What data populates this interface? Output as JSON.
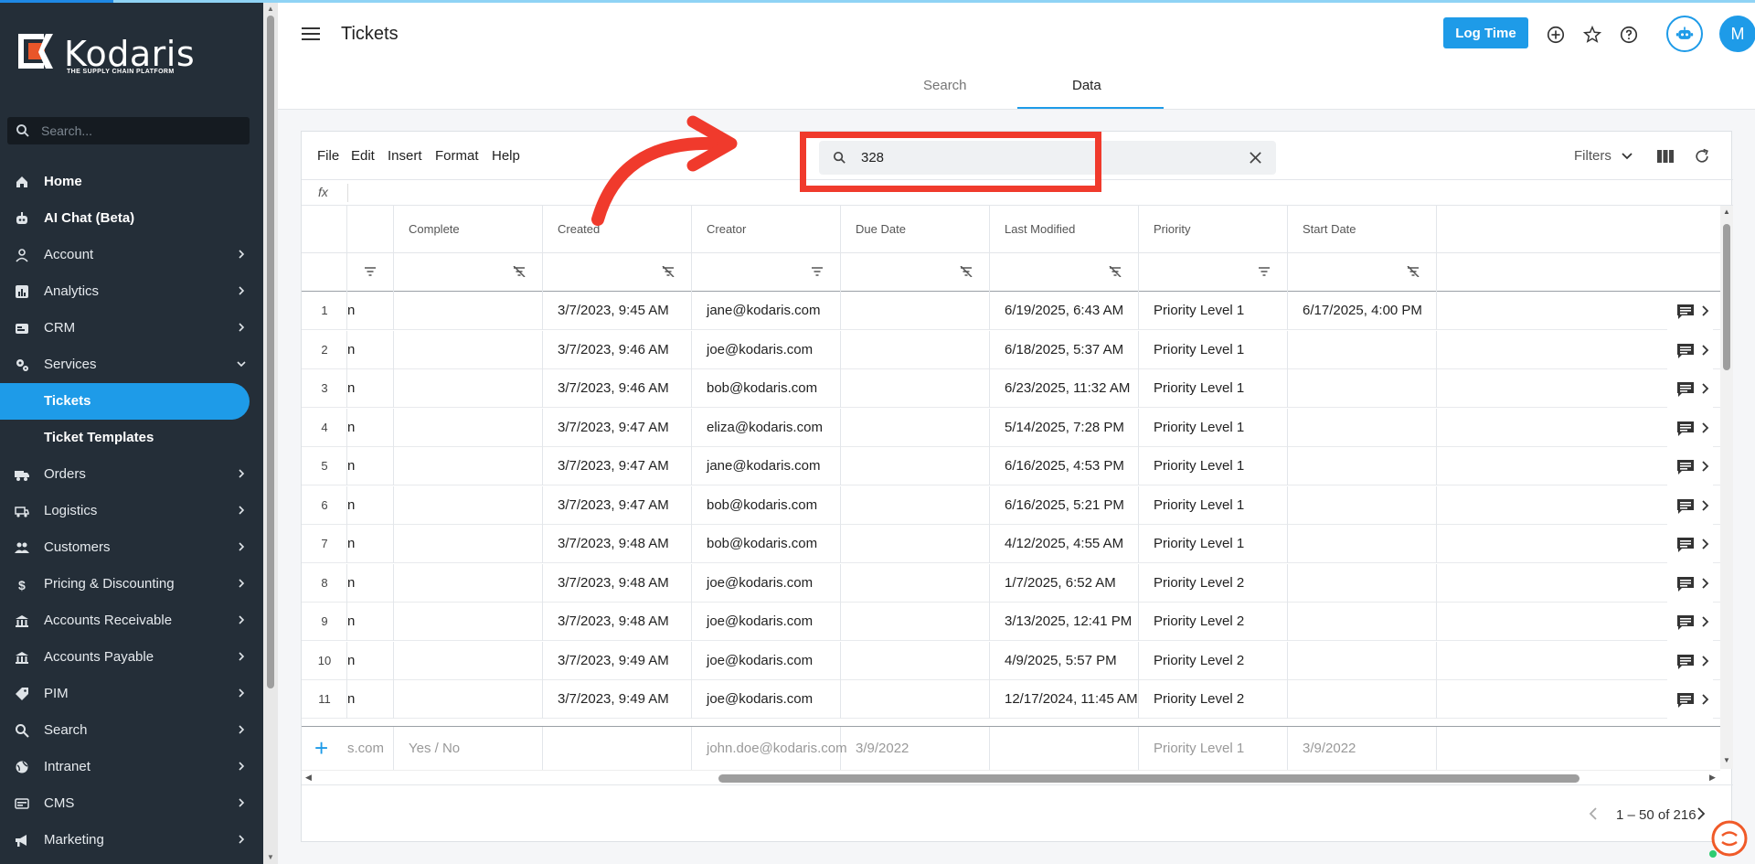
{
  "app": {
    "brand_name": "Kodaris",
    "brand_tagline": "THE SUPPLY CHAIN PLATFORM",
    "page_title": "Tickets"
  },
  "sidebar": {
    "search_placeholder": "Search...",
    "items": [
      {
        "label": "Home",
        "icon": "home-icon",
        "bold": true,
        "chevron": false
      },
      {
        "label": "AI Chat (Beta)",
        "icon": "robot-icon",
        "bold": true,
        "chevron": false
      },
      {
        "label": "Account",
        "icon": "person-icon",
        "chevron": true
      },
      {
        "label": "Analytics",
        "icon": "chart-icon",
        "chevron": true
      },
      {
        "label": "CRM",
        "icon": "crm-icon",
        "chevron": true
      },
      {
        "label": "Services",
        "icon": "gears-icon",
        "chevron": true,
        "expanded": true
      },
      {
        "label": "Tickets",
        "active": true,
        "sub": true
      },
      {
        "label": "Ticket Templates",
        "sub": true
      },
      {
        "label": "Orders",
        "icon": "truck-icon",
        "chevron": true
      },
      {
        "label": "Logistics",
        "icon": "logistics-icon",
        "chevron": true
      },
      {
        "label": "Customers",
        "icon": "people-icon",
        "chevron": true
      },
      {
        "label": "Pricing & Discounting",
        "icon": "dollar-icon",
        "chevron": true
      },
      {
        "label": "Accounts Receivable",
        "icon": "bank-icon",
        "chevron": true
      },
      {
        "label": "Accounts Payable",
        "icon": "bank-icon",
        "chevron": true
      },
      {
        "label": "PIM",
        "icon": "tag-icon",
        "chevron": true
      },
      {
        "label": "Search",
        "icon": "search-icon",
        "chevron": true
      },
      {
        "label": "Intranet",
        "icon": "globe-icon",
        "chevron": true
      },
      {
        "label": "CMS",
        "icon": "cms-icon",
        "chevron": true
      },
      {
        "label": "Marketing",
        "icon": "megaphone-icon",
        "chevron": true
      }
    ]
  },
  "header": {
    "log_time_label": "Log Time",
    "avatar_initial": "M",
    "tabs": [
      {
        "label": "Search",
        "active": false
      },
      {
        "label": "Data",
        "active": true
      }
    ]
  },
  "toolbar": {
    "menus": [
      "File",
      "Edit",
      "Insert",
      "Format",
      "Help"
    ],
    "search_value": "328",
    "filters_label": "Filters",
    "formula_label": "fx"
  },
  "grid": {
    "columns": [
      "Complete",
      "Created",
      "Creator",
      "Due Date",
      "Last Modified",
      "Priority",
      "Start Date"
    ],
    "rows": [
      {
        "n": "1",
        "c0": "n",
        "complete": "",
        "created": "3/7/2023, 9:45 AM",
        "creator": "jane@kodaris.com",
        "due": "",
        "modified": "6/19/2025, 6:43 AM",
        "priority": "Priority Level 1",
        "start": "6/17/2025, 4:00 PM"
      },
      {
        "n": "2",
        "c0": "n",
        "complete": "",
        "created": "3/7/2023, 9:46 AM",
        "creator": "joe@kodaris.com",
        "due": "",
        "modified": "6/18/2025, 5:37 AM",
        "priority": "Priority Level 1",
        "start": ""
      },
      {
        "n": "3",
        "c0": "n",
        "complete": "",
        "created": "3/7/2023, 9:46 AM",
        "creator": "bob@kodaris.com",
        "due": "",
        "modified": "6/23/2025, 11:32 AM",
        "priority": "Priority Level 1",
        "start": ""
      },
      {
        "n": "4",
        "c0": "n",
        "complete": "",
        "created": "3/7/2023, 9:47 AM",
        "creator": "eliza@kodaris.com",
        "due": "",
        "modified": "5/14/2025, 7:28 PM",
        "priority": "Priority Level 1",
        "start": ""
      },
      {
        "n": "5",
        "c0": "n",
        "complete": "",
        "created": "3/7/2023, 9:47 AM",
        "creator": "jane@kodaris.com",
        "due": "",
        "modified": "6/16/2025, 4:53 PM",
        "priority": "Priority Level 1",
        "start": ""
      },
      {
        "n": "6",
        "c0": "n",
        "complete": "",
        "created": "3/7/2023, 9:47 AM",
        "creator": "bob@kodaris.com",
        "due": "",
        "modified": "6/16/2025, 5:21 PM",
        "priority": "Priority Level 1",
        "start": ""
      },
      {
        "n": "7",
        "c0": "n",
        "complete": "",
        "created": "3/7/2023, 9:48 AM",
        "creator": "bob@kodaris.com",
        "due": "",
        "modified": "4/12/2025, 4:55 AM",
        "priority": "Priority Level 1",
        "start": ""
      },
      {
        "n": "8",
        "c0": "n",
        "complete": "",
        "created": "3/7/2023, 9:48 AM",
        "creator": "joe@kodaris.com",
        "due": "",
        "modified": "1/7/2025, 6:52 AM",
        "priority": "Priority Level 2",
        "start": ""
      },
      {
        "n": "9",
        "c0": "n",
        "complete": "",
        "created": "3/7/2023, 9:48 AM",
        "creator": "joe@kodaris.com",
        "due": "",
        "modified": "3/13/2025, 12:41 PM",
        "priority": "Priority Level 2",
        "start": ""
      },
      {
        "n": "10",
        "c0": "n",
        "complete": "",
        "created": "3/7/2023, 9:49 AM",
        "creator": "joe@kodaris.com",
        "due": "",
        "modified": "4/9/2025, 5:57 PM",
        "priority": "Priority Level 2",
        "start": ""
      },
      {
        "n": "11",
        "c0": "n",
        "complete": "",
        "created": "3/7/2023, 9:49 AM",
        "creator": "joe@kodaris.com",
        "due": "",
        "modified": "12/17/2024, 11:45 AM",
        "priority": "Priority Level 2",
        "start": ""
      }
    ],
    "new_row_placeholders": {
      "c0": "s.com",
      "complete": "Yes / No",
      "created": "",
      "creator": "john.doe@kodaris.com",
      "due": "3/9/2022",
      "modified": "",
      "priority": "Priority Level 1",
      "start": "3/9/2022"
    },
    "pagination": "1 – 50 of 216"
  },
  "colors": {
    "sidebar_bg": "#242e38",
    "accent": "#1e9be8",
    "annotation_red": "#f03a2c",
    "help_orange": "#f05a28"
  }
}
